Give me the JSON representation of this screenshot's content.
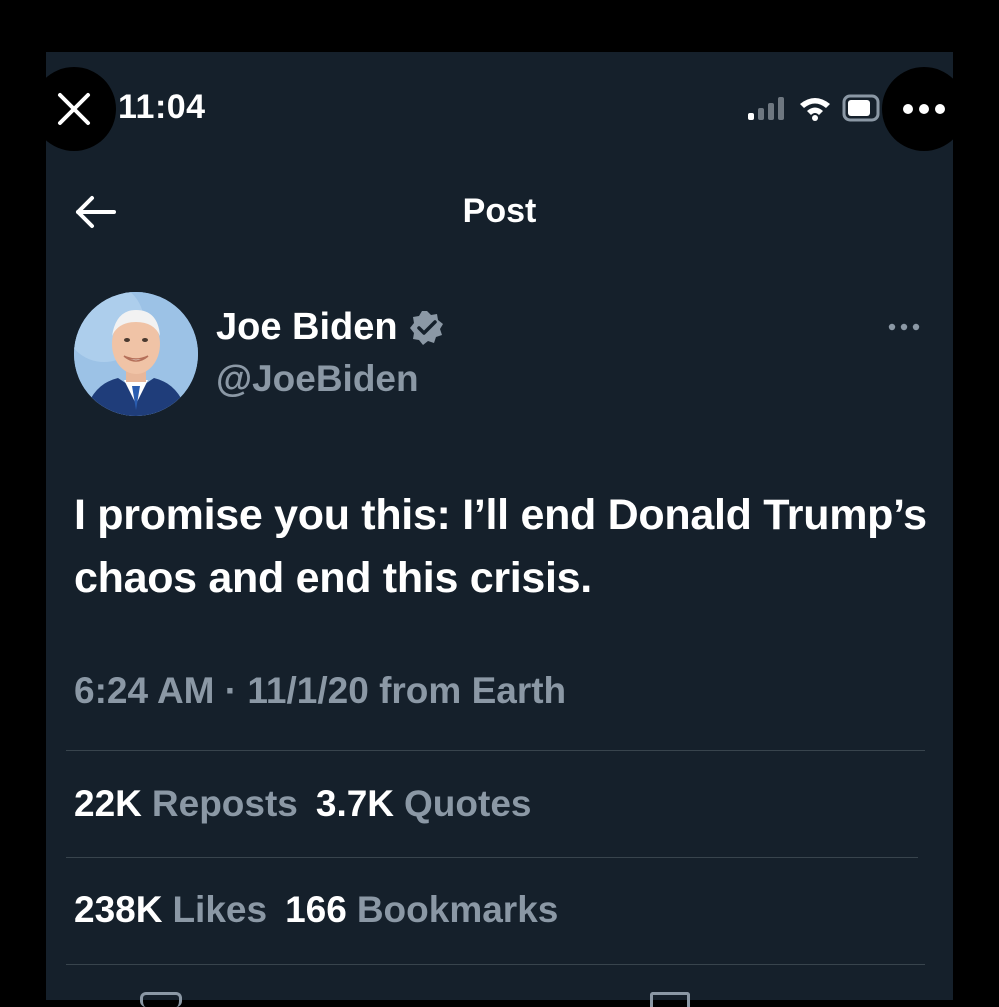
{
  "status_bar": {
    "time": "11:04",
    "icons": [
      "signal-icon",
      "wifi-icon",
      "battery-icon"
    ]
  },
  "overlay": {
    "close_icon": "close-icon",
    "more_icon": "more-options-icon"
  },
  "header": {
    "title": "Post",
    "back_icon": "back-arrow-icon"
  },
  "post": {
    "author_name": "Joe Biden",
    "verified_icon": "verified-badge-icon",
    "handle": "@JoeBiden",
    "text": "I promise you this: I’ll end Donald Trump’s chaos and end this crisis.",
    "timestamp": "6:24 AM · 11/1/20 from Earth",
    "more_icon": "more-options-icon"
  },
  "stats": {
    "reposts_count": "22K",
    "reposts_label": "Reposts",
    "quotes_count": "3.7K",
    "quotes_label": "Quotes",
    "likes_count": "238K",
    "likes_label": "Likes",
    "bookmarks_count": "166",
    "bookmarks_label": "Bookmarks"
  },
  "colors": {
    "background": "#15202b",
    "secondary_text": "#8b98a5",
    "divider": "#38444d",
    "verified_badge": "#8b98a5"
  }
}
